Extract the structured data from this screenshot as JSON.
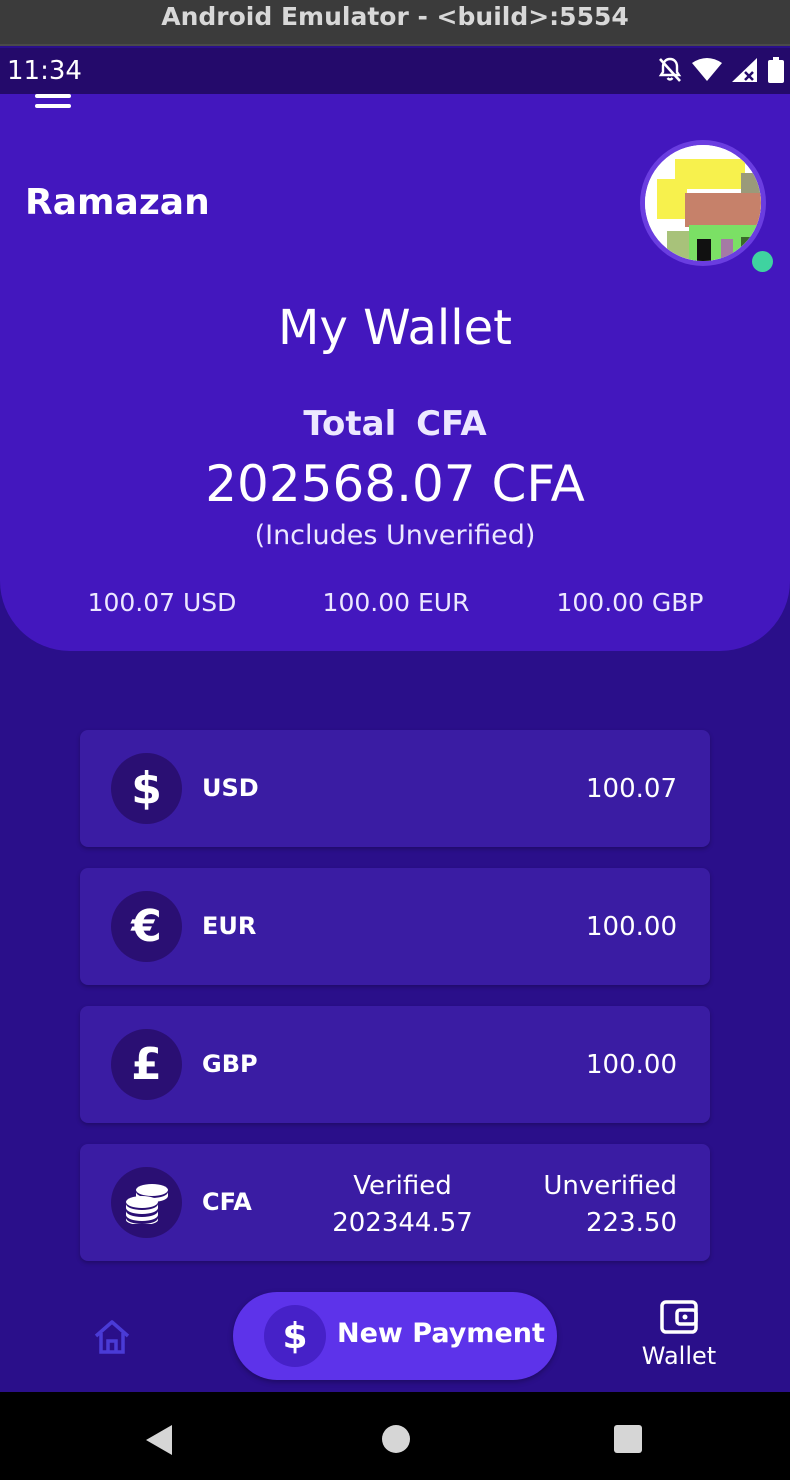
{
  "emulator": {
    "title": "Android Emulator - <build>:5554"
  },
  "status_bar": {
    "time": "11:34",
    "icons": [
      "bell-off-icon",
      "wifi-icon",
      "signal-icon",
      "battery-icon"
    ]
  },
  "header": {
    "user_name": "Ramazan",
    "title": "My Wallet",
    "total_label": "Total  CFA",
    "total_value": "202568.07 CFA",
    "total_note": "(Includes Unverified)",
    "sub_balances": [
      {
        "text": "100.07 USD"
      },
      {
        "text": "100.00 EUR"
      },
      {
        "text": "100.00 GBP"
      }
    ],
    "online_color": "#3fd3a0"
  },
  "cards": [
    {
      "icon": "dollar-icon",
      "symbol": "$",
      "code": "USD",
      "amount": "100.07"
    },
    {
      "icon": "euro-icon",
      "symbol": "€",
      "code": "EUR",
      "amount": "100.00"
    },
    {
      "icon": "pound-icon",
      "symbol": "£",
      "code": "GBP",
      "amount": "100.00"
    },
    {
      "icon": "coins-icon",
      "code": "CFA",
      "verified_label": "Verified",
      "verified_amount": "202344.57",
      "unverified_label": "Unverified",
      "unverified_amount": "223.50"
    }
  ],
  "bottom_nav": {
    "new_payment_symbol": "$",
    "new_payment_label": "New Payment",
    "wallet_label": "Wallet"
  },
  "colors": {
    "header_bg": "#4317be",
    "page_bg": "#2a0f8a",
    "card_bg": "#3a1ca3",
    "accent": "#5d33ea"
  }
}
